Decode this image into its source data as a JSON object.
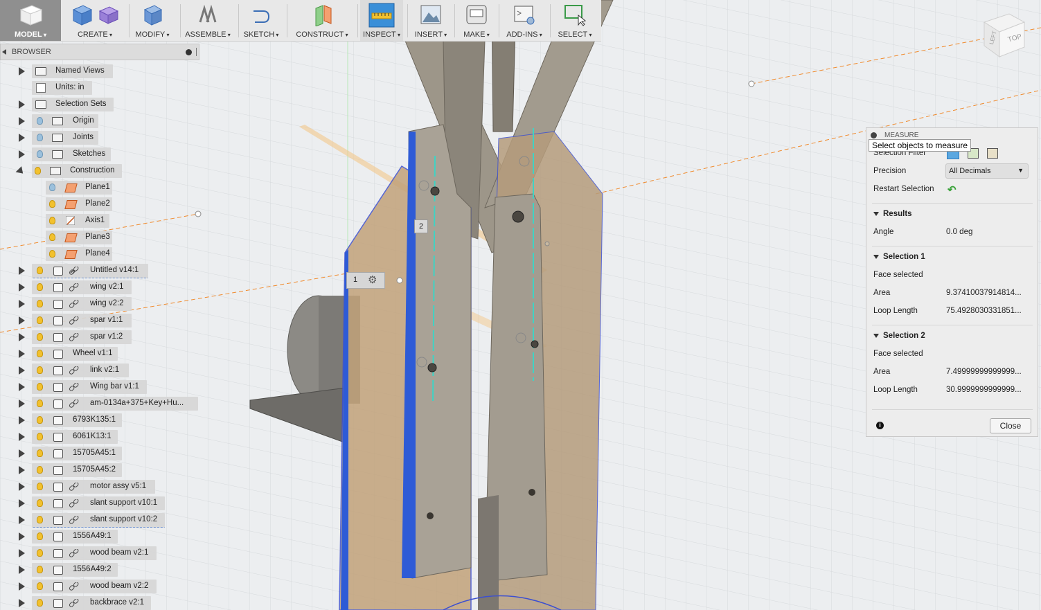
{
  "toolbar": {
    "model": "MODEL",
    "create": "CREATE",
    "modify": "MODIFY",
    "assemble": "ASSEMBLE",
    "sketch": "SKETCH",
    "construct": "CONSTRUCT",
    "inspect": "INSPECT",
    "insert": "INSERT",
    "make": "MAKE",
    "addins": "ADD-INS",
    "select": "SELECT"
  },
  "viewcube": {
    "left": "LEFT",
    "top": "TOP"
  },
  "browser": {
    "title": "BROWSER",
    "items": [
      {
        "label": "Named Views"
      },
      {
        "label": "Units: in"
      },
      {
        "label": "Selection Sets"
      },
      {
        "label": "Origin"
      },
      {
        "label": "Joints"
      },
      {
        "label": "Sketches"
      },
      {
        "label": "Construction"
      },
      {
        "label": "Plane1"
      },
      {
        "label": "Plane2"
      },
      {
        "label": "Axis1"
      },
      {
        "label": "Plane3"
      },
      {
        "label": "Plane4"
      },
      {
        "label": "Untitled v14:1"
      },
      {
        "label": "wing v2:1"
      },
      {
        "label": "wing v2:2"
      },
      {
        "label": "spar v1:1"
      },
      {
        "label": "spar v1:2"
      },
      {
        "label": "Wheel v1:1"
      },
      {
        "label": "link v2:1"
      },
      {
        "label": "Wing bar v1:1"
      },
      {
        "label": "am-0134a+375+Key+Hu..."
      },
      {
        "label": "6793K135:1"
      },
      {
        "label": "6061K13:1"
      },
      {
        "label": "15705A45:1"
      },
      {
        "label": "15705A45:2"
      },
      {
        "label": "motor assy v5:1"
      },
      {
        "label": "slant support v10:1"
      },
      {
        "label": "slant support v10:2"
      },
      {
        "label": "1556A49:1"
      },
      {
        "label": "wood beam v2:1"
      },
      {
        "label": "1556A49:2"
      },
      {
        "label": "wood beam v2:2"
      },
      {
        "label": "backbrace v2:1"
      }
    ]
  },
  "canvas_markers": {
    "one": "1",
    "two": "2"
  },
  "measure": {
    "title": "MEASURE",
    "tooltip": "Select objects to measure",
    "selection_filter_label": "Selection Filter",
    "precision_label": "Precision",
    "precision_value": "All Decimals",
    "restart_label": "Restart Selection",
    "results_head": "Results",
    "angle_label": "Angle",
    "angle_value": "0.0 deg",
    "sel1_head": "Selection 1",
    "sel1_type": "Face selected",
    "sel1_area_label": "Area",
    "sel1_area_value": "9.37410037914814...",
    "sel1_loop_label": "Loop Length",
    "sel1_loop_value": "75.4928030331851...",
    "sel2_head": "Selection 2",
    "sel2_type": "Face selected",
    "sel2_area_label": "Area",
    "sel2_area_value": "7.49999999999999...",
    "sel2_loop_label": "Loop Length",
    "sel2_loop_value": "30.9999999999999...",
    "close_label": "Close"
  }
}
